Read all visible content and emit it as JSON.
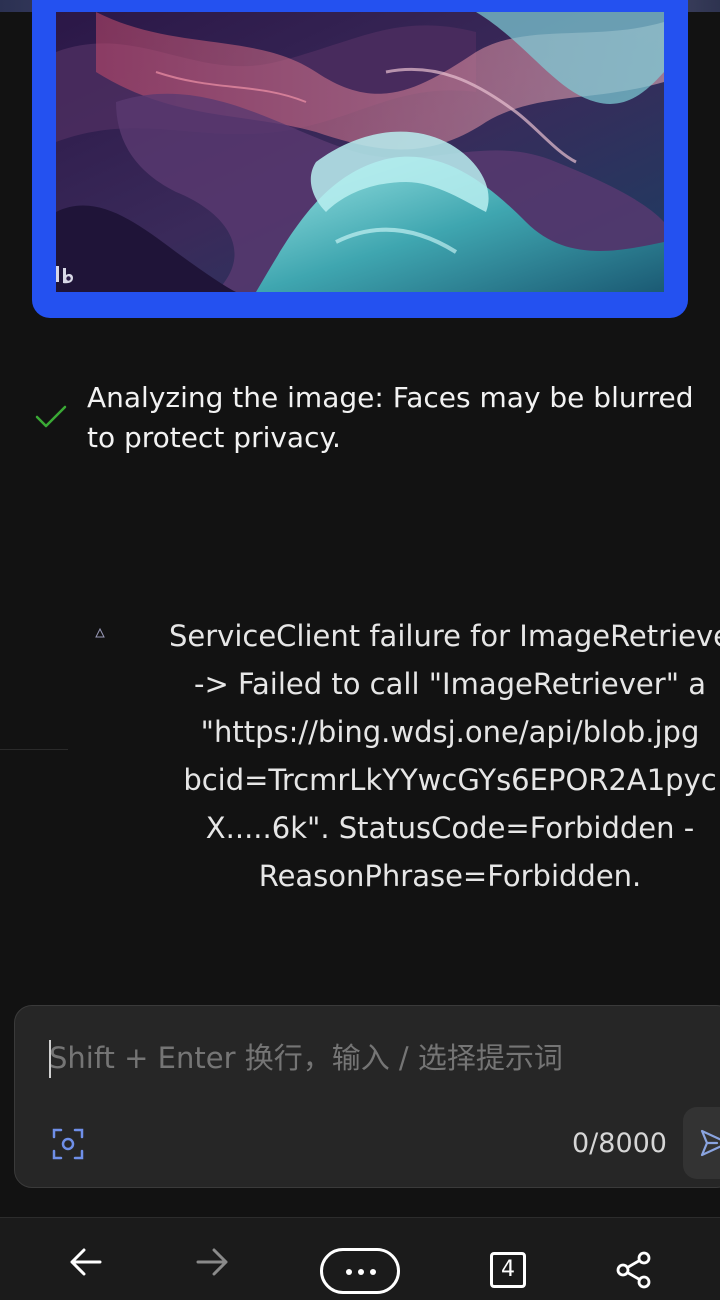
{
  "generated_image": {
    "watermark_icon": "bing-logo-icon",
    "accent_color": "#2451f0"
  },
  "status": {
    "icon": "check-icon",
    "icon_color": "#3aa935",
    "text": "Analyzing the image: Faces may be blurred to protect privacy."
  },
  "error": {
    "icon": "warning-icon",
    "lines": [
      "ServiceClient failure for ImageRetrieve",
      "-> Failed to call \"ImageRetriever\" a",
      "\"https://bing.wdsj.one/api/blob.jpg",
      "bcid=TrcmrLkYYwcGYs6EPOR2A1pyc",
      "X.....6k\". StatusCode=Forbidden -",
      "ReasonPhrase=Forbidden."
    ]
  },
  "composer": {
    "placeholder": "Shift + Enter 换行，输入 / 选择提示词",
    "value": "",
    "char_count": "0/8000",
    "scan_icon": "scan-icon",
    "send_icon": "send-icon"
  },
  "bottom_nav": {
    "back_icon": "arrow-left-icon",
    "forward_icon": "arrow-right-icon",
    "more_icon": "more-dots-icon",
    "tab_count": "4",
    "share_icon": "share-icon"
  }
}
